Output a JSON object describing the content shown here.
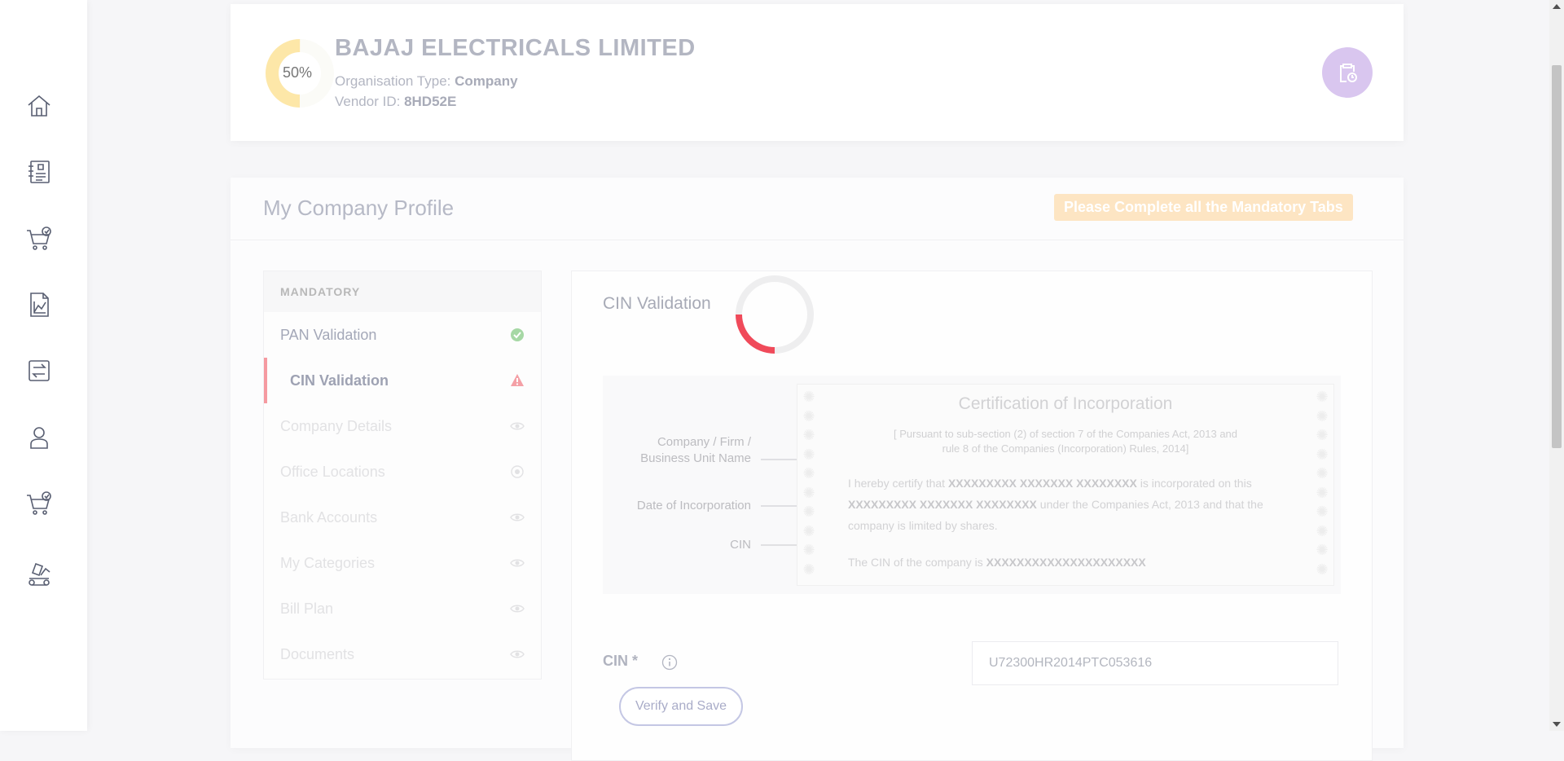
{
  "nav": {
    "items": [
      {
        "icon": "home-icon"
      },
      {
        "icon": "catalog-icon"
      },
      {
        "icon": "cart-check-icon"
      },
      {
        "icon": "report-chart-icon"
      },
      {
        "icon": "transfer-icon"
      },
      {
        "icon": "user-icon"
      },
      {
        "icon": "cart-check-icon-2"
      },
      {
        "icon": "conveyor-icon"
      }
    ]
  },
  "header": {
    "progress_text": "50%",
    "progress_value": 0.5,
    "company_name": "BAJAJ ELECTRICALS LIMITED",
    "org_type_label": "Organisation Type: ",
    "org_type_value": "Company",
    "vendor_id_label": "Vendor ID: ",
    "vendor_id_value": "8HD52E",
    "action_icon": "clipboard-clock-icon",
    "colors": {
      "progress": "#fde7a8",
      "action_bg": "#d9c6ef"
    }
  },
  "profile": {
    "title": "My Company Profile",
    "badge": "Please Complete all the Mandatory Tabs"
  },
  "tabs": {
    "header": "MANDATORY",
    "items": [
      {
        "label": "PAN Validation",
        "state": "done",
        "icon": "check-circle-icon"
      },
      {
        "label": "CIN Validation",
        "state": "active",
        "icon": "warning-triangle-icon"
      },
      {
        "label": "Company Details",
        "state": "pending",
        "icon": "eye-icon"
      },
      {
        "label": "Office Locations",
        "state": "pending",
        "icon": "eye-icon"
      },
      {
        "label": "Bank Accounts",
        "state": "pending",
        "icon": "eye-icon"
      },
      {
        "label": "My Categories",
        "state": "pending",
        "icon": "eye-icon"
      },
      {
        "label": "Bill Plan",
        "state": "pending",
        "icon": "eye-icon"
      },
      {
        "label": "Documents",
        "state": "pending",
        "icon": "eye-icon"
      }
    ]
  },
  "content": {
    "title": "CIN Validation",
    "certificate": {
      "heading": "Certification of Incorporation",
      "sub_line1": "[ Pursuant to sub-section (2) of section 7 of the Companies Act, 2013 and",
      "sub_line2": "rule 8 of the Companies (Incorporation) Rules, 2014]",
      "p1_a": "I hereby certify that ",
      "p1_name": "XXXXXXXXX XXXXXXX XXXXXXXX",
      "p1_b": " is incorporated on this",
      "p2_date": "XXXXXXXXX XXXXXXX XXXXXXXX",
      "p2_b": " under the Companies Act, 2013 and that the",
      "p3": "company is limited by shares.",
      "p4_a": "The CIN of the company is ",
      "p4_cin": "XXXXXXXXXXXXXXXXXXXXX",
      "label_name": "Company / Firm /\nBusiness Unit Name",
      "label_date": "Date of Incorporation",
      "label_cin": "CIN"
    },
    "cin_label": "CIN *",
    "cin_value": "U72300HR2014PTC053616",
    "verify_button": "Verify and Save"
  }
}
